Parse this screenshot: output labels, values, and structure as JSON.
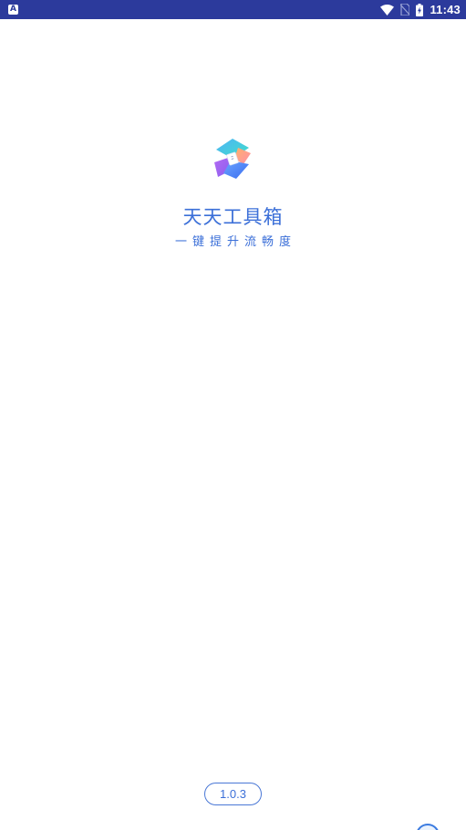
{
  "status_bar": {
    "notification_icon": "A",
    "time": "11:43",
    "icons": [
      "wifi-icon",
      "no-sim-icon",
      "battery-charging-icon"
    ],
    "background_color": "#2c3a9c"
  },
  "splash": {
    "logo_icon": "app-logo-icon",
    "app_name": "天天工具箱",
    "slogan": "一键提升流畅度",
    "accent_color": "#3b6fd8"
  },
  "footer": {
    "version": "1.0.3"
  }
}
